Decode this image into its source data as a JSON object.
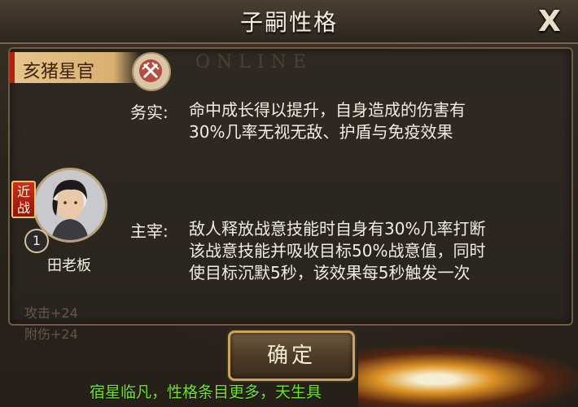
{
  "dialog": {
    "title": "子嗣性格",
    "close_label": "X",
    "watermark": "ONLINE"
  },
  "trait_set": {
    "name": "亥猪星官",
    "emblem_icon": "crossed-swords-icon"
  },
  "traits": [
    {
      "label": "务实:",
      "lines": [
        "命中成长得以提升，自身造成的伤害有",
        "30%几率无视无敌、护盾与免疫效果"
      ]
    },
    {
      "label": "主宰:",
      "lines": [
        "敌人释放战意技能时自身有30%几率打断",
        "该战意技能并吸收目标50%战意值，同时",
        "使目标沉默5秒，该效果每5秒触发一次"
      ]
    }
  ],
  "hero": {
    "type_badge_line1": "近",
    "type_badge_line2": "战",
    "level": "1",
    "name": "田老板"
  },
  "faded": {
    "line1": "攻击+24",
    "line2": "附伤+24"
  },
  "actions": {
    "confirm_label": "确定"
  },
  "footer": {
    "text": "宿星临凡，性格条目更多，天生具"
  },
  "colors": {
    "accent_green": "#76e02f",
    "banner_red": "#b51f10",
    "gold_border": "#c9a45e"
  }
}
